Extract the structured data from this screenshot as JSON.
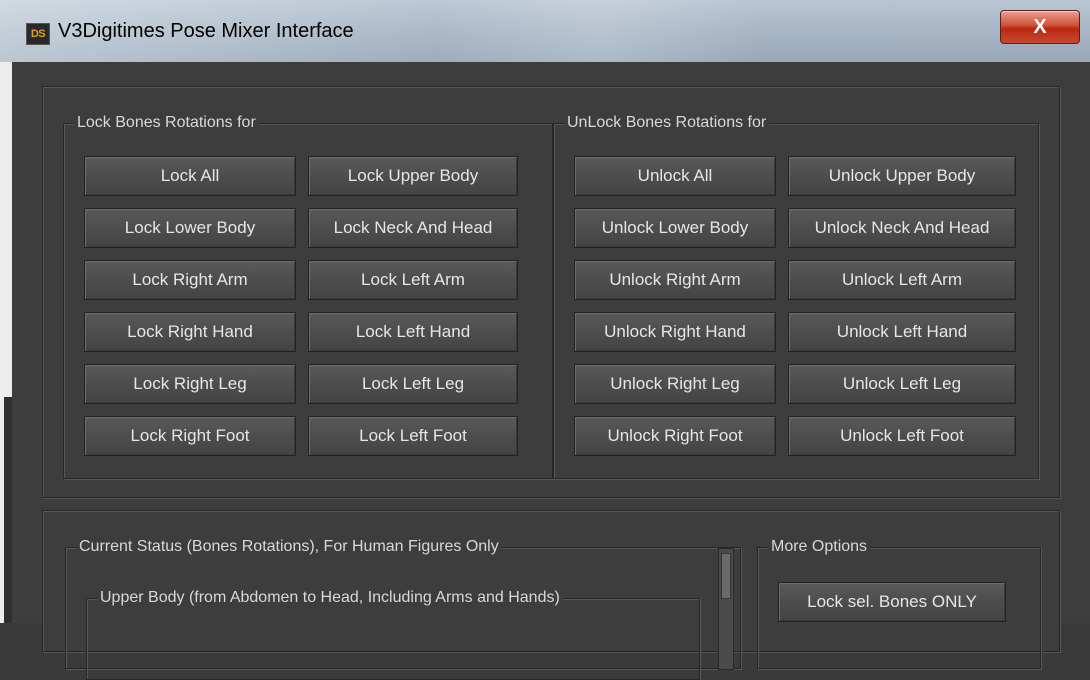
{
  "window": {
    "title": "V3Digitimes Pose Mixer Interface",
    "app_icon_text": "DS",
    "close_label": "X"
  },
  "lock_group": {
    "title": "Lock Bones Rotations for",
    "buttons": [
      "Lock All",
      "Lock Upper Body",
      "Lock Lower Body",
      "Lock Neck And Head",
      "Lock Right Arm",
      "Lock Left Arm",
      "Lock Right Hand",
      "Lock Left Hand",
      "Lock Right Leg",
      "Lock Left Leg",
      "Lock Right Foot",
      "Lock Left Foot"
    ]
  },
  "unlock_group": {
    "title": "UnLock Bones Rotations for",
    "buttons": [
      "Unlock All",
      "Unlock Upper Body",
      "Unlock Lower Body",
      "Unlock Neck And Head",
      "Unlock Right Arm",
      "Unlock Left Arm",
      "Unlock Right Hand",
      "Unlock Left Hand",
      "Unlock Right Leg",
      "Unlock Left Leg",
      "Unlock Right Foot",
      "Unlock Left Foot"
    ]
  },
  "status_group": {
    "title": "Current Status (Bones Rotations), For Human Figures Only",
    "upper_body_title": "Upper Body (from Abdomen to Head, Including Arms and Hands)"
  },
  "more_options": {
    "title": "More Options",
    "lock_selected_label": "Lock sel. Bones ONLY"
  }
}
